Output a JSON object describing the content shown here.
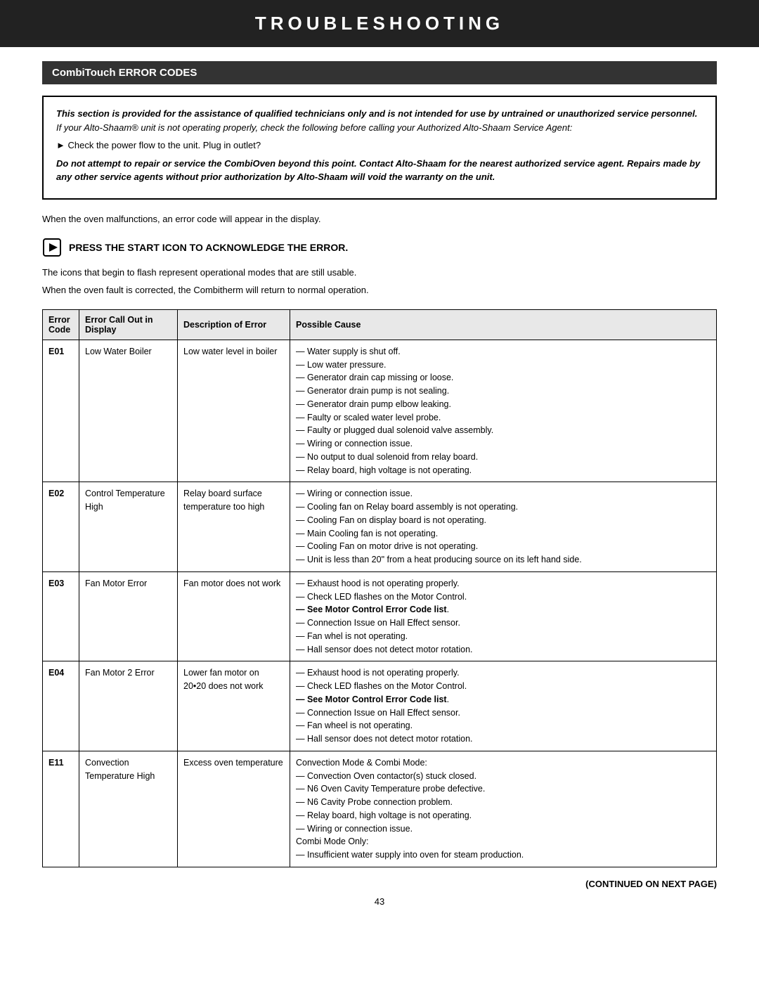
{
  "header": {
    "title": "TROUBLESHOOTING"
  },
  "section": {
    "title": "CombiTouch ERROR CODES"
  },
  "warning": {
    "line1_bold_italic": "This section is provided for the assistance of qualified technicians only and is not intended for use by untrained or unauthorized service personnel.",
    "line1_normal": " If your Alto-Shaam® unit is not operating properly, check the following before calling your Authorized Alto-Shaam Service Agent:",
    "bullet": "Check the power flow to the unit. Plug in outlet?",
    "line2_italic_bold": "Do not attempt to repair or service the CombiOven beyond this point. Contact Alto-Shaam for the nearest authorized service agent. Repairs made by any other service agents without prior authorization by Alto-Shaam will void the warranty on the unit."
  },
  "body": {
    "line1": "When the oven malfunctions, an error code will appear in the display.",
    "press_start": "PRESS THE START ICON TO ACKNOWLEDGE THE ERROR.",
    "line2": "The icons that begin to flash represent operational modes that are still usable.",
    "line3": "When the oven fault is corrected, the Combitherm will return to normal operation."
  },
  "table": {
    "headers": [
      "Error Code",
      "Error Call Out in Display",
      "Description of Error",
      "Possible Cause"
    ],
    "rows": [
      {
        "code": "E01",
        "display": "Low Water Boiler",
        "description": "Low water level in boiler",
        "causes": [
          "— Water supply is shut off.",
          "— Low water pressure.",
          "— Generator drain cap missing or loose.",
          "— Generator drain pump is not sealing.",
          "— Generator drain pump elbow leaking.",
          "— Faulty or scaled water level probe.",
          "— Faulty or plugged dual solenoid valve assembly.",
          "— Wiring or connection issue.",
          "— No output to dual solenoid from relay board.",
          "— Relay board, high voltage is not operating."
        ]
      },
      {
        "code": "E02",
        "display": "Control Temperature High",
        "description": "Relay board surface temperature too high",
        "causes": [
          "— Wiring or connection issue.",
          "— Cooling fan on Relay board assembly is not operating.",
          "— Cooling Fan on display board is not operating.",
          "— Main Cooling fan is not operating.",
          "— Cooling Fan on motor drive is not operating.",
          "— Unit is less than 20\" from a heat producing source on its left hand side."
        ]
      },
      {
        "code": "E03",
        "display": "Fan Motor Error",
        "description": "Fan motor does not work",
        "causes": [
          "— Exhaust hood is not operating properly.",
          "— Check LED flashes on the Motor Control.",
          "— See Motor Control Error Code list.",
          "— Connection Issue on Hall Effect sensor.",
          "— Fan whel is not operating.",
          "— Hall sensor does not detect motor rotation."
        ],
        "cause_bold_index": 2
      },
      {
        "code": "E04",
        "display": "Fan Motor 2 Error",
        "description": "Lower fan motor on 20•20 does not work",
        "causes": [
          "— Exhaust hood is not operating properly.",
          "— Check LED flashes on the Motor Control.",
          "— See Motor Control Error Code list.",
          "— Connection Issue on Hall Effect sensor.",
          "— Fan wheel is not operating.",
          "— Hall sensor does not detect motor rotation."
        ],
        "cause_bold_index": 2
      },
      {
        "code": "E11",
        "display": "Convection Temperature High",
        "description": "Excess oven temperature",
        "causes": [
          "Convection Mode & Combi Mode:",
          "— Convection Oven contactor(s) stuck closed.",
          "— N6 Oven Cavity Temperature probe defective.",
          "— N6 Cavity Probe connection problem.",
          "— Relay board, high voltage is not operating.",
          "— Wiring or connection issue.",
          "Combi Mode Only:",
          "— Insufficient water supply into oven for steam production."
        ]
      }
    ]
  },
  "footer": {
    "continued": "(CONTINUED ON NEXT PAGE)",
    "page_number": "43"
  }
}
